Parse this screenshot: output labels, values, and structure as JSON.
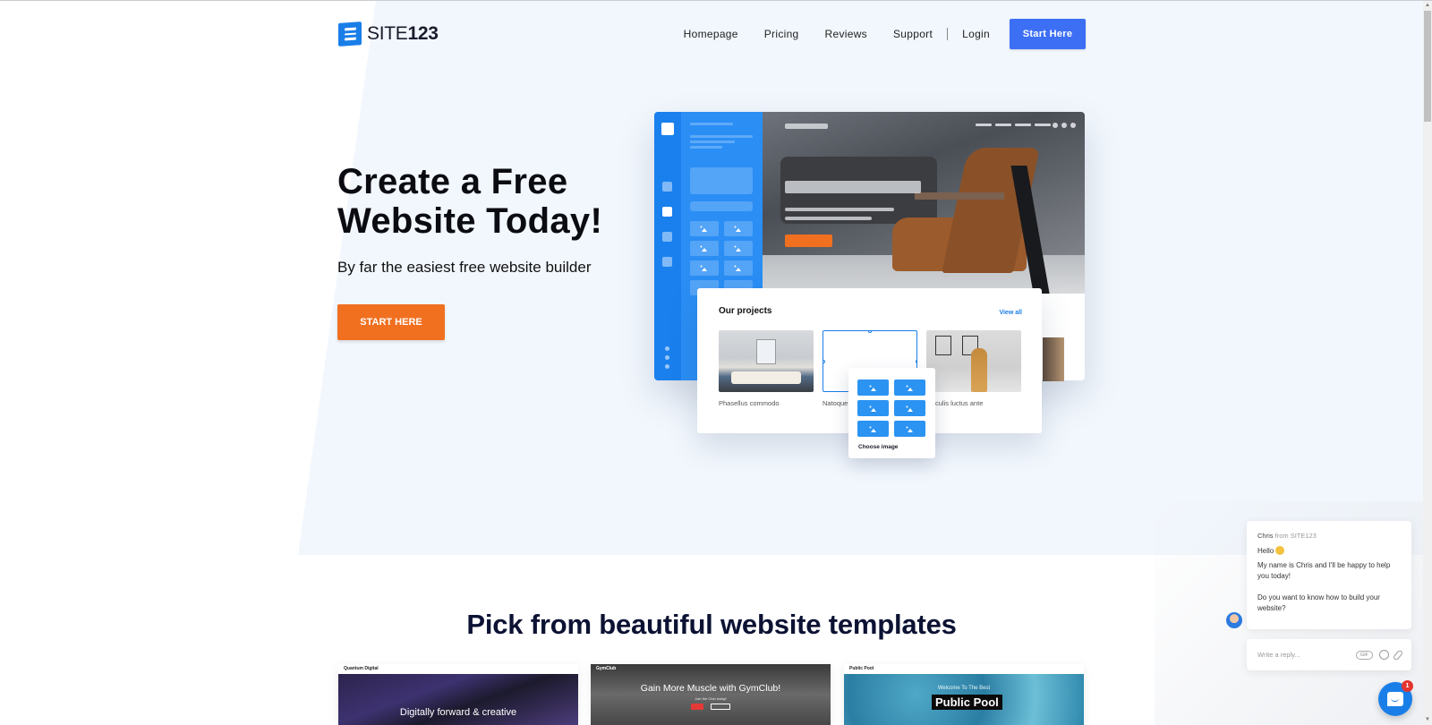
{
  "header": {
    "logo": {
      "prefix": "SITE",
      "suffix": "123",
      "icon": "site123-logo-icon"
    },
    "nav": [
      {
        "label": "Homepage"
      },
      {
        "label": "Pricing"
      },
      {
        "label": "Reviews"
      },
      {
        "label": "Support"
      }
    ],
    "login_label": "Login",
    "cta_label": "Start Here"
  },
  "hero": {
    "title_line1": "Create a Free",
    "title_line2": "Website Today!",
    "subtitle": "By far the easiest free website builder",
    "button_label": "START HERE",
    "colors": {
      "accent_orange": "#f07020",
      "brand_blue": "#1a7ee8",
      "cta_blue": "#3d6ff5"
    }
  },
  "mockup": {
    "projects_title": "Our projects",
    "view_all": "View all",
    "projects": [
      {
        "caption": "Phasellus commodo"
      },
      {
        "caption": "Natoque"
      },
      {
        "caption": "culis luctus ante"
      }
    ],
    "chooser_label": "Choose image"
  },
  "templates": {
    "title": "Pick from beautiful website templates",
    "items": [
      {
        "brand": "Quantum Digital",
        "headline": "Digitally forward & creative"
      },
      {
        "brand": "GymClub",
        "headline": "Gain More Muscle with GymClub!",
        "sub": "Join the Club today!"
      },
      {
        "brand": "Public Pool",
        "headline": "Public Pool",
        "sub": "Welcome To The Best"
      }
    ]
  },
  "chat": {
    "agent": "Chris",
    "from_text": "from SITE123",
    "hello": "Hello",
    "message1": "My name is Chris and I'll be happy to help you today!",
    "message2": "Do you want to know how to build your website?",
    "reply_placeholder": "Write a reply...",
    "gif_label": "GIF",
    "unread_count": "1"
  }
}
